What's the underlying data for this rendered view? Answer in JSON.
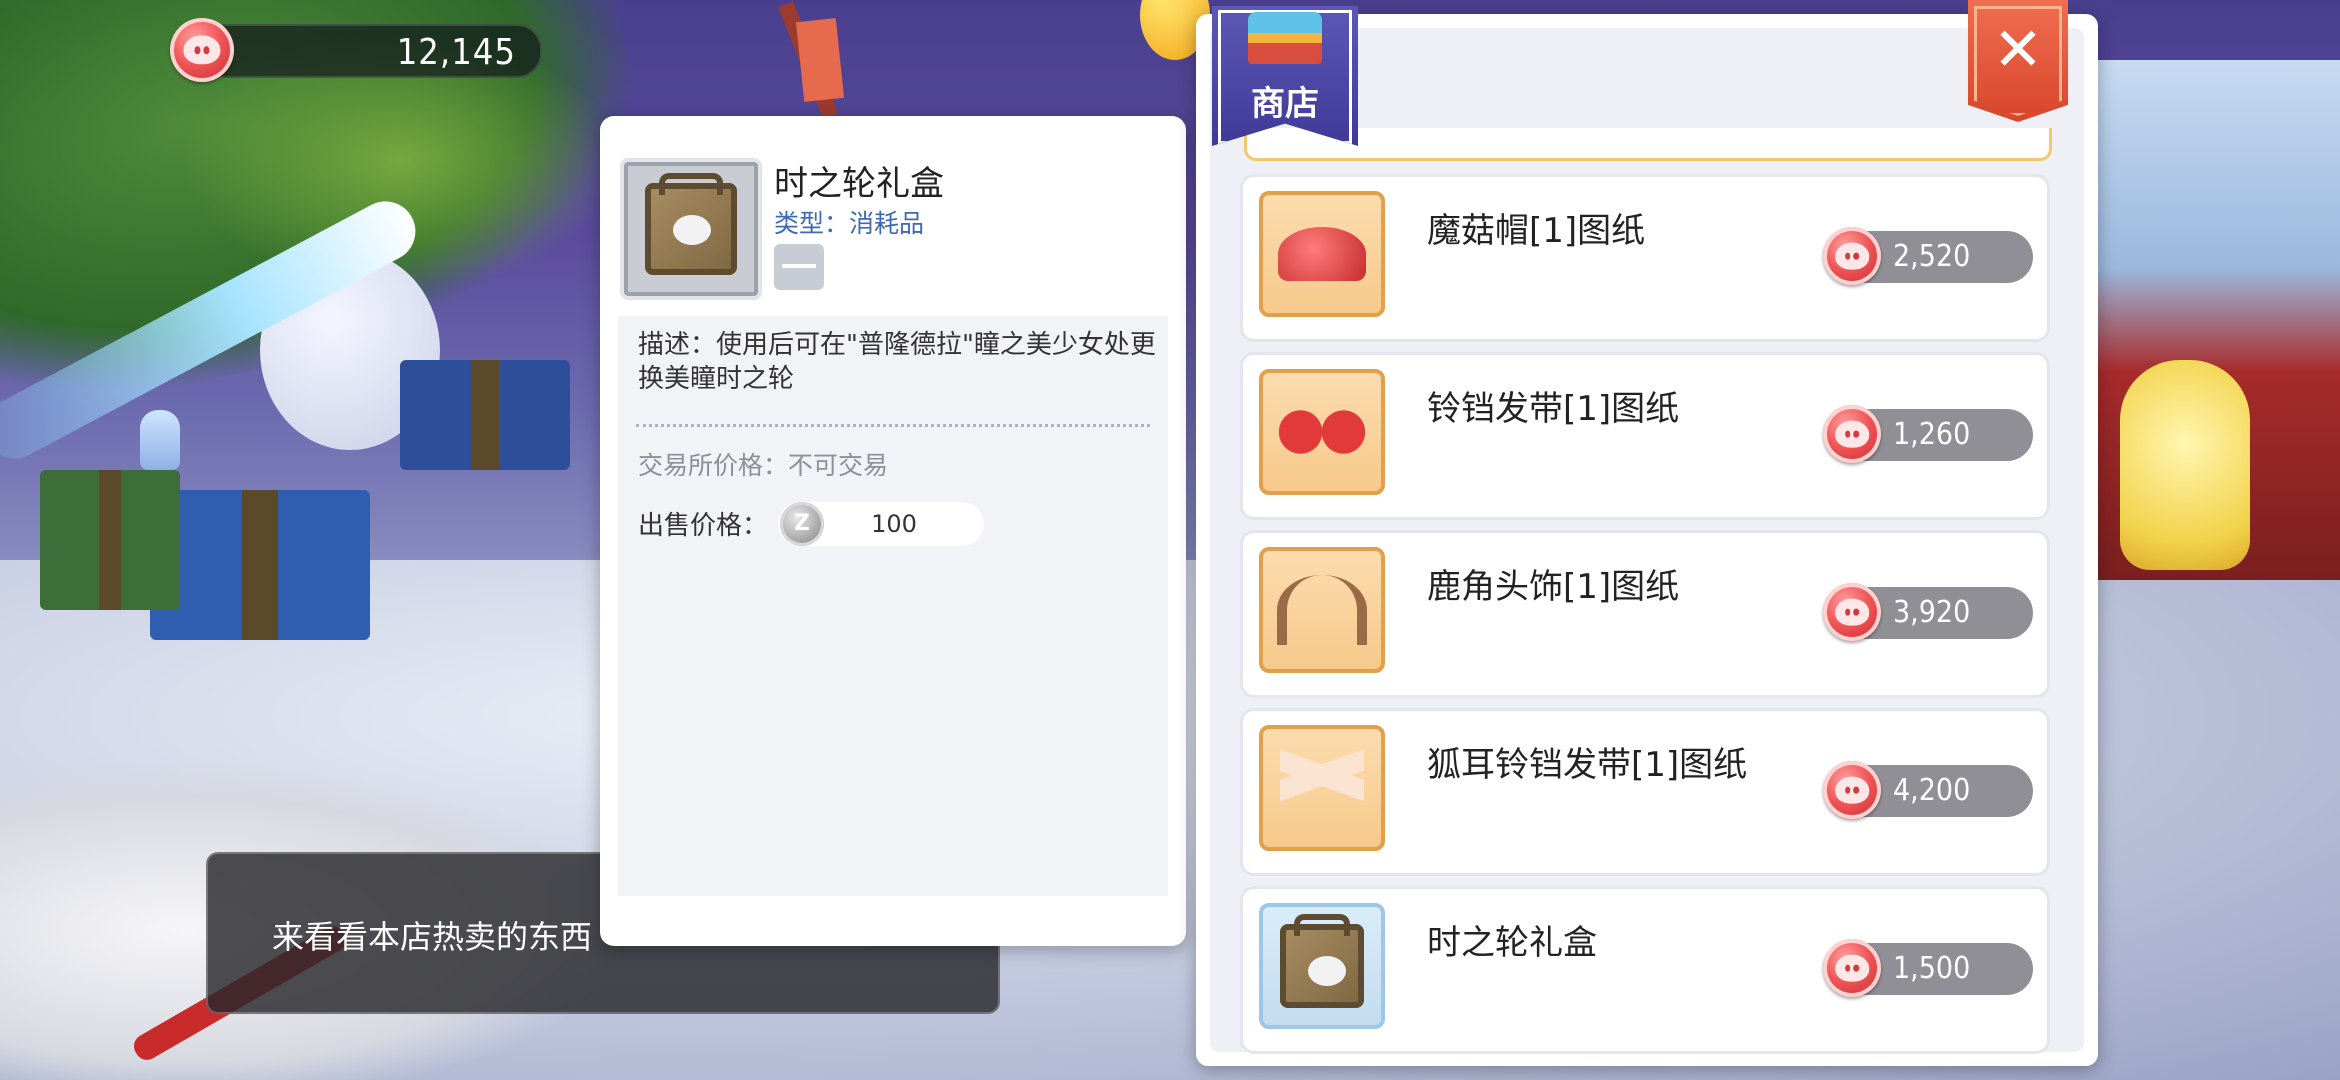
{
  "currency": {
    "amount": "12,145",
    "icon": "pig-coin-icon"
  },
  "tooltip": {
    "item_name": "时之轮礼盒",
    "item_type": "类型：消耗品",
    "description": "描述：使用后可在\"普隆德拉\"瞳之美少女处更换美瞳时之轮",
    "trade_price": "交易所价格：不可交易",
    "sell_label": "出售价格：",
    "sell_value": "100"
  },
  "dialogue": {
    "text": "来看看本店热卖的东西"
  },
  "shop": {
    "title": "商店",
    "close_symbol": "✕",
    "items": [
      {
        "name": "魔菇帽[1]图纸",
        "price": "2,520",
        "frame": "orange",
        "icon": "mushroom-hat-blueprint-icon"
      },
      {
        "name": "铃铛发带[1]图纸",
        "price": "1,260",
        "frame": "orange",
        "icon": "bell-ribbon-blueprint-icon"
      },
      {
        "name": "鹿角头饰[1]图纸",
        "price": "3,920",
        "frame": "orange",
        "icon": "antler-headgear-blueprint-icon"
      },
      {
        "name": "狐耳铃铛发带[1]图纸",
        "price": "4,200",
        "frame": "orange",
        "icon": "fox-ear-ribbon-blueprint-icon"
      },
      {
        "name": "时之轮礼盒",
        "price": "1,500",
        "frame": "blue",
        "icon": "gift-box-icon"
      }
    ]
  }
}
